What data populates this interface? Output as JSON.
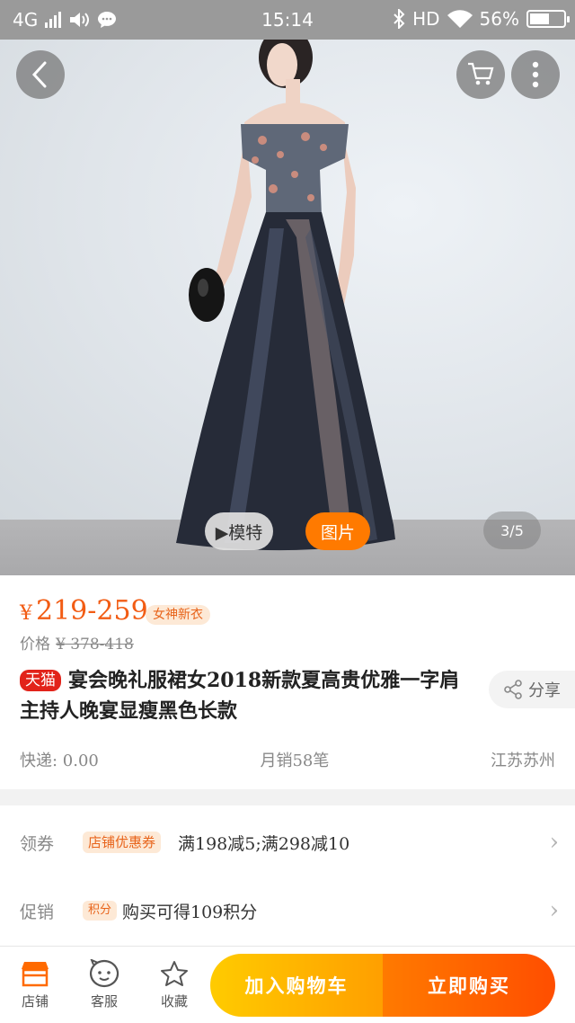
{
  "status_bar": {
    "network": "4G",
    "time": "15:14",
    "hd": "HD",
    "battery": "56%"
  },
  "hero": {
    "model_button": "▶模特",
    "picture_button": "图片",
    "pager": "3/5"
  },
  "product": {
    "currency": "¥",
    "price": "219-259",
    "tag": "女神新衣",
    "original_label": "价格",
    "original_price": "¥ 378-418",
    "platform_badge": "天猫",
    "title": "宴会晚礼服裙女2018新款夏高贵优雅一字肩主持人晚宴显瘦黑色长款",
    "share_label": "分享",
    "shipping": "快递: 0.00",
    "monthly_sales": "月销58笔",
    "location": "江苏苏州"
  },
  "promotions": {
    "coupon": {
      "label": "领券",
      "badge": "店铺优惠券",
      "text": "满198减5;满298减10"
    },
    "promo": {
      "label": "促销",
      "badge": "积分",
      "text": "购买可得109积分"
    }
  },
  "bottom_bar": {
    "shop_label": "店铺",
    "service_label": "客服",
    "favorite_label": "收藏",
    "add_to_cart": "加入购物车",
    "buy_now": "立即购买"
  },
  "colors": {
    "price": "#f25c14",
    "tmall": "#e2231a",
    "cart_button": "#ffb300",
    "buy_button": "#ff5a00"
  }
}
